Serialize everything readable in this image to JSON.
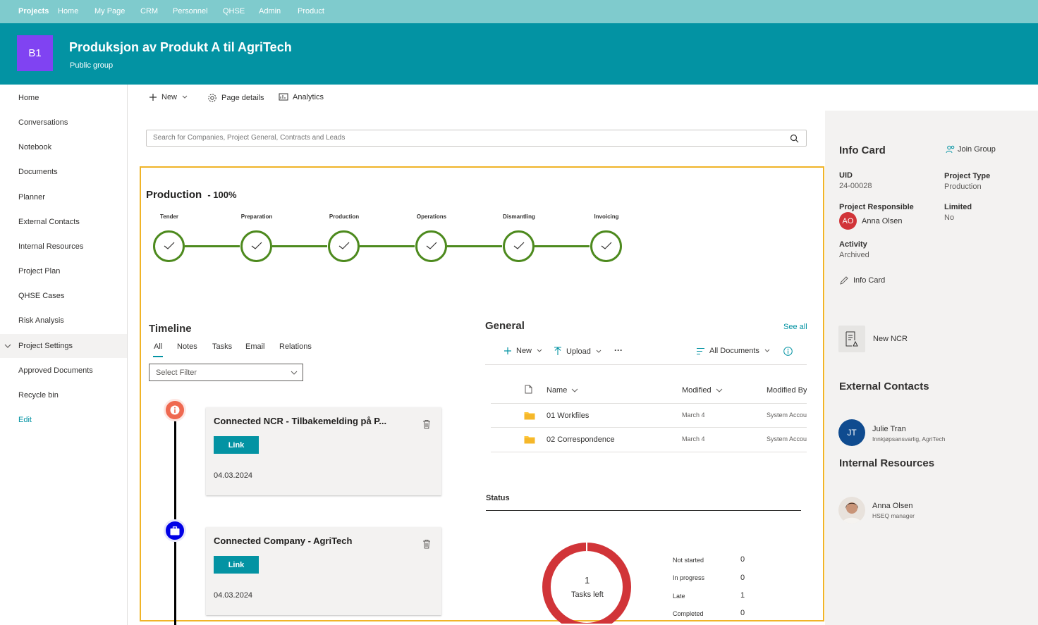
{
  "topnav": {
    "items": [
      "Projects",
      "Home",
      "My Page",
      "CRM",
      "Personnel",
      "QHSE",
      "Admin",
      "Product"
    ]
  },
  "site": {
    "logo": "B1",
    "title": "Produksjon av Produkt A til AgriTech",
    "subtitle": "Public group"
  },
  "leftnav": {
    "items": [
      "Home",
      "Conversations",
      "Notebook",
      "Documents",
      "Planner",
      "External Contacts",
      "Internal Resources",
      "Project Plan",
      "QHSE Cases",
      "Risk Analysis",
      "Project Settings",
      "Approved Documents",
      "Recycle bin"
    ],
    "edit": "Edit"
  },
  "commandbar": {
    "new": "New",
    "page_details": "Page details",
    "analytics": "Analytics"
  },
  "search": {
    "placeholder": "Search for Companies, Project General, Contracts and Leads"
  },
  "production": {
    "title": "Production",
    "percent": "- 100%",
    "progress": 1.0,
    "steps": [
      "Tender",
      "Preparation",
      "Production",
      "Operations",
      "Dismantling",
      "Invoicing"
    ],
    "color": "#4d8a1e"
  },
  "timeline": {
    "title": "Timeline",
    "tabs": [
      "All",
      "Notes",
      "Tasks",
      "Email",
      "Relations"
    ],
    "filter": "Select Filter",
    "cards": [
      {
        "title": "Connected NCR - Tilbakemelding på P...",
        "button": "Link",
        "date": "04.03.2024"
      },
      {
        "title": "Connected Company - AgriTech",
        "button": "Link",
        "date": "04.03.2024"
      }
    ]
  },
  "general": {
    "title": "General",
    "see_all": "See all",
    "new": "New",
    "upload": "Upload",
    "more": "···",
    "view": "All Documents",
    "columns": {
      "name": "Name",
      "modified": "Modified",
      "modified_by": "Modified By"
    },
    "rows": [
      {
        "name": "01 Workfiles",
        "modified": "March 4",
        "by": "System Account"
      },
      {
        "name": "02 Correspondence",
        "modified": "March 4",
        "by": "System Account"
      }
    ]
  },
  "status": {
    "title": "Status",
    "count": "1",
    "count_label": "Tasks left",
    "ring_color": "#d13438",
    "legend": [
      {
        "label": "Not started",
        "value": "0"
      },
      {
        "label": "In progress",
        "value": "0"
      },
      {
        "label": "Late",
        "value": "1"
      },
      {
        "label": "Completed",
        "value": "0"
      }
    ]
  },
  "infocard": {
    "title": "Info Card",
    "join": "Join Group",
    "uid_label": "UID",
    "uid": "24-00028",
    "type_label": "Project Type",
    "type": "Production",
    "resp_label": "Project Responsible",
    "resp_initials": "AO",
    "resp": "Anna Olsen",
    "limited_label": "Limited",
    "limited": "No",
    "activity_label": "Activity",
    "activity": "Archived",
    "edit": "Info Card",
    "new_ncr": "New NCR"
  },
  "external": {
    "title": "External Contacts",
    "initials": "JT",
    "name": "Julie Tran",
    "role": "Innkjøpsansvarlig, AgriTech"
  },
  "internal": {
    "title": "Internal Resources",
    "name": "Anna Olsen",
    "role": "HSEQ manager"
  }
}
